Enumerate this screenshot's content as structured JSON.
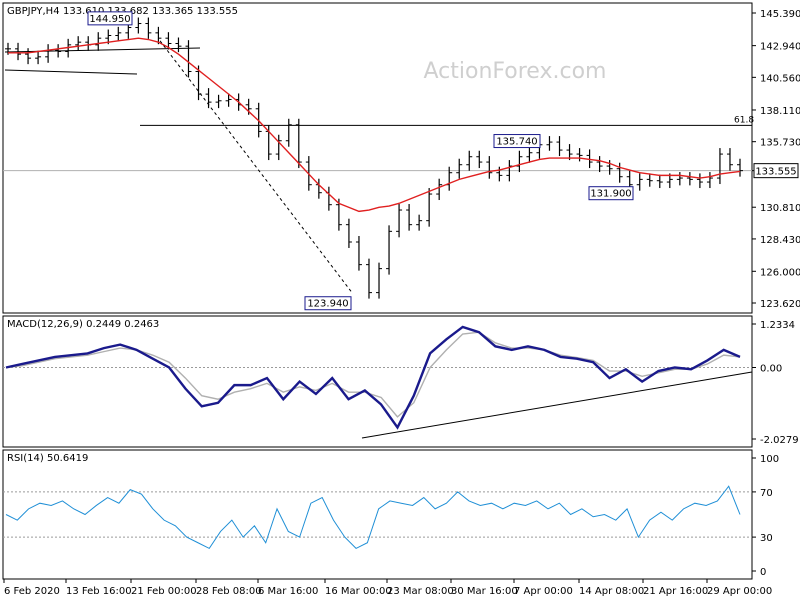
{
  "header": {
    "symbol": "GBPJPY,H4",
    "ohlc": "133.610 133.682 133.365 133.555",
    "watermark": "ActionForex.com"
  },
  "colors": {
    "bar": "#000000",
    "ma": "#e02020",
    "macd": "#1a1a8c",
    "signal": "#b0b0b0",
    "rsi": "#1f8fd6",
    "label_box": "#1a1a8c",
    "guide_dash": "#9a9a9a"
  },
  "chart_data": [
    {
      "type": "line",
      "panel": "price",
      "title": "GBPJPY,H4",
      "ylim": [
        123.62,
        145.39
      ],
      "yticks": [
        "145.390",
        "142.940",
        "140.560",
        "138.110",
        "135.730",
        "133.555",
        "130.810",
        "128.430",
        "126.000",
        "123.620"
      ],
      "ytick_values": [
        145.39,
        142.94,
        140.56,
        138.11,
        135.73,
        133.555,
        130.81,
        128.43,
        126.0,
        123.62
      ],
      "x_ticks": [
        "6 Feb 2020",
        "13 Feb 16:00",
        "21 Feb 00:00",
        "28 Feb 08:00",
        "6 Mar 16:00",
        "16 Mar 00:00",
        "23 Mar 08:00",
        "30 Mar 16:00",
        "7 Apr 00:00",
        "14 Apr 08:00",
        "21 Apr 16:00",
        "29 Apr 00:00"
      ],
      "close": [
        142.7,
        142.3,
        142.0,
        142.1,
        142.6,
        142.5,
        143.0,
        143.2,
        143.0,
        143.5,
        143.7,
        143.9,
        144.3,
        144.6,
        143.9,
        143.5,
        143.1,
        142.9,
        141.0,
        139.3,
        138.7,
        138.8,
        138.9,
        138.5,
        138.2,
        136.5,
        134.8,
        135.8,
        137.0,
        134.2,
        132.5,
        131.9,
        131.0,
        129.5,
        128.2,
        126.5,
        124.4,
        126.2,
        129.0,
        130.6,
        129.5,
        129.8,
        131.8,
        132.5,
        133.4,
        134.0,
        134.6,
        134.2,
        133.4,
        133.2,
        133.9,
        134.6,
        134.9,
        135.5,
        135.7,
        135.1,
        134.8,
        134.7,
        134.2,
        133.9,
        133.7,
        133.1,
        132.5,
        132.9,
        132.8,
        132.7,
        132.9,
        133.0,
        132.9,
        132.7,
        133.0,
        134.8,
        134.0,
        133.555
      ],
      "ma_series": [
        142.4,
        142.4,
        142.4,
        142.5,
        142.6,
        142.7,
        142.8,
        142.9,
        143.0,
        143.1,
        143.2,
        143.3,
        143.4,
        143.5,
        143.4,
        143.2,
        142.8,
        142.3,
        141.7,
        141.1,
        140.5,
        139.9,
        139.3,
        138.7,
        138.0,
        137.3,
        136.5,
        135.7,
        134.9,
        134.1,
        133.3,
        132.5,
        131.8,
        131.1,
        130.8,
        130.5,
        130.6,
        130.8,
        130.9,
        131.1,
        131.4,
        131.7,
        132.0,
        132.3,
        132.6,
        132.9,
        133.1,
        133.3,
        133.5,
        133.6,
        133.8,
        134.0,
        134.2,
        134.4,
        134.5,
        134.5,
        134.5,
        134.5,
        134.4,
        134.3,
        134.1,
        133.8,
        133.6,
        133.4,
        133.3,
        133.2,
        133.2,
        133.2,
        133.1,
        133.0,
        133.1,
        133.3,
        133.4,
        133.5
      ],
      "fib_level": {
        "value": 136.95,
        "label": "61.8"
      },
      "annotations": [
        {
          "text": "144.950",
          "value": 144.95
        },
        {
          "text": "123.940",
          "value": 123.94
        },
        {
          "text": "135.740",
          "value": 135.74
        },
        {
          "text": "131.900",
          "value": 131.9
        }
      ],
      "current_price": {
        "text": "133.555",
        "value": 133.555
      }
    },
    {
      "type": "line",
      "panel": "macd",
      "title": "MACD(12,26,9) 0.2449 0.2463",
      "ylim": [
        -2.0279,
        1.2334
      ],
      "yticks": [
        "1.2334",
        "0.00",
        "-2.0279"
      ],
      "ytick_values": [
        1.2334,
        0.0,
        -2.0279
      ],
      "macd": [
        0.0,
        0.1,
        0.2,
        0.3,
        0.35,
        0.4,
        0.55,
        0.65,
        0.5,
        0.25,
        0.0,
        -0.6,
        -1.1,
        -1.0,
        -0.5,
        -0.5,
        -0.3,
        -0.9,
        -0.4,
        -0.75,
        -0.3,
        -0.9,
        -0.65,
        -1.05,
        -1.7,
        -0.8,
        0.4,
        0.8,
        1.15,
        1.0,
        0.6,
        0.5,
        0.6,
        0.5,
        0.3,
        0.25,
        0.15,
        -0.3,
        -0.05,
        -0.4,
        -0.1,
        0.0,
        -0.05,
        0.2,
        0.5,
        0.3
      ],
      "signal": [
        0.0,
        0.05,
        0.15,
        0.25,
        0.3,
        0.35,
        0.45,
        0.55,
        0.5,
        0.35,
        0.15,
        -0.3,
        -0.8,
        -0.9,
        -0.7,
        -0.6,
        -0.45,
        -0.7,
        -0.55,
        -0.65,
        -0.45,
        -0.7,
        -0.7,
        -0.85,
        -1.4,
        -1.0,
        0.0,
        0.5,
        0.95,
        1.0,
        0.7,
        0.55,
        0.55,
        0.5,
        0.35,
        0.28,
        0.2,
        -0.1,
        -0.1,
        -0.25,
        -0.15,
        -0.05,
        -0.05,
        0.1,
        0.35,
        0.3
      ]
    },
    {
      "type": "line",
      "panel": "rsi",
      "title": "RSI(14) 50.6419",
      "ylim": [
        0,
        100
      ],
      "yticks": [
        "100",
        "70",
        "30",
        "0"
      ],
      "ytick_values": [
        100,
        70,
        30,
        0
      ],
      "levels": [
        70,
        30
      ],
      "rsi": [
        50,
        45,
        55,
        60,
        58,
        62,
        55,
        50,
        58,
        65,
        60,
        72,
        68,
        55,
        45,
        40,
        30,
        25,
        20,
        35,
        45,
        30,
        40,
        25,
        55,
        35,
        30,
        60,
        65,
        45,
        30,
        20,
        25,
        55,
        62,
        60,
        58,
        65,
        55,
        60,
        70,
        62,
        58,
        60,
        55,
        60,
        58,
        62,
        55,
        60,
        50,
        55,
        48,
        50,
        45,
        55,
        30,
        45,
        52,
        45,
        55,
        60,
        58,
        62,
        75,
        50
      ]
    }
  ]
}
